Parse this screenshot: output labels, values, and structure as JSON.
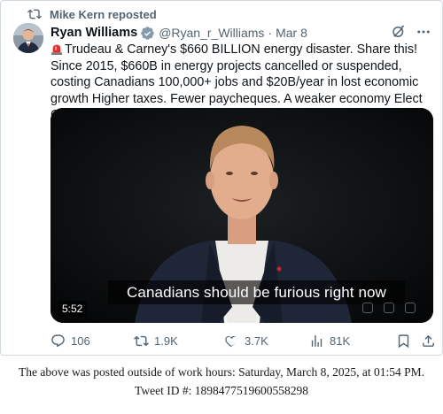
{
  "repost": {
    "label": "Mike Kern reposted",
    "icon": "repost-icon"
  },
  "author": {
    "name": "Ryan Williams",
    "handle": "@Ryan_r_Williams",
    "separator": "·",
    "date": "Mar 8",
    "verified": true
  },
  "tweet": {
    "text": "Trudeau & Carney's $660 BILLION energy disaster. Share this! Since 2015, $660B in energy projects cancelled or suspended, costing Canadians 100,000+ jobs and $20B/year in lost economic growth Higher taxes. Fewer paycheques. A weaker economy Elect Conservatives to stop this"
  },
  "media": {
    "caption": "Canadians should be furious right now",
    "duration": "5:52"
  },
  "actions": {
    "replies": "106",
    "reposts": "1.9K",
    "likes": "3.7K",
    "views": "81K"
  },
  "footer": {
    "line1": "The above was posted outside of work hours: Saturday, March 8, 2025, at 01:54 PM.",
    "line2": "Tweet ID #: 1898477519600558298"
  },
  "colors": {
    "accent": "#1d9bf0",
    "muted": "#536471",
    "text": "#0f1419"
  }
}
